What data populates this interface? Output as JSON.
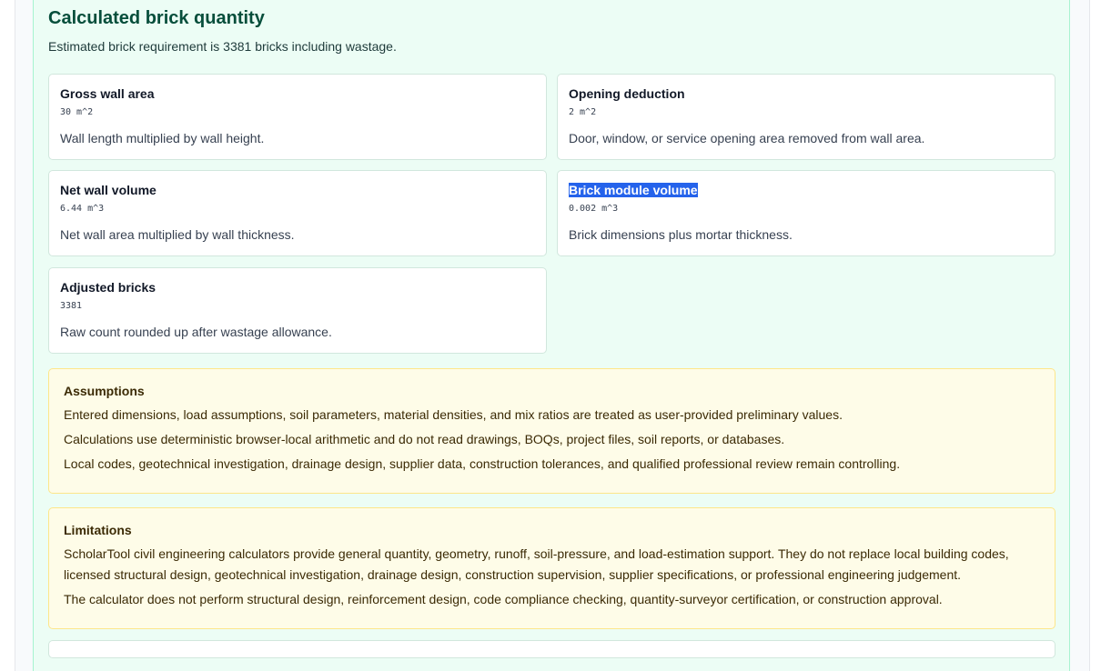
{
  "result": {
    "title": "Calculated brick quantity",
    "summary": "Estimated brick requirement is 3381 bricks including wastage."
  },
  "cards": [
    {
      "title": "Gross wall area",
      "value": "30 m^2",
      "description": "Wall length multiplied by wall height."
    },
    {
      "title": "Opening deduction",
      "value": "2 m^2",
      "description": "Door, window, or service opening area removed from wall area."
    },
    {
      "title": "Net wall volume",
      "value": "6.44 m^3",
      "description": "Net wall area multiplied by wall thickness."
    },
    {
      "title": "Brick module volume",
      "value": "0.002 m^3",
      "description": "Brick dimensions plus mortar thickness."
    },
    {
      "title": "Adjusted bricks",
      "value": "3381",
      "description": "Raw count rounded up after wastage allowance."
    }
  ],
  "assumptions": {
    "title": "Assumptions",
    "lines": [
      "Entered dimensions, load assumptions, soil parameters, material densities, and mix ratios are treated as user-provided preliminary values.",
      "Calculations use deterministic browser-local arithmetic and do not read drawings, BOQs, project files, soil reports, or databases.",
      "Local codes, geotechnical investigation, drainage design, supplier data, construction tolerances, and qualified professional review remain controlling."
    ]
  },
  "limitations": {
    "title": "Limitations",
    "lines": [
      "ScholarTool civil engineering calculators provide general quantity, geometry, runoff, soil-pressure, and load-estimation support. They do not replace local building codes, licensed structural design, geotechnical investigation, drainage design, construction supervision, supplier specifications, or professional engineering judgement.",
      "The calculator does not perform structural design, reinforcement design, code compliance checking, quantity-surveyor certification, or construction approval."
    ]
  }
}
